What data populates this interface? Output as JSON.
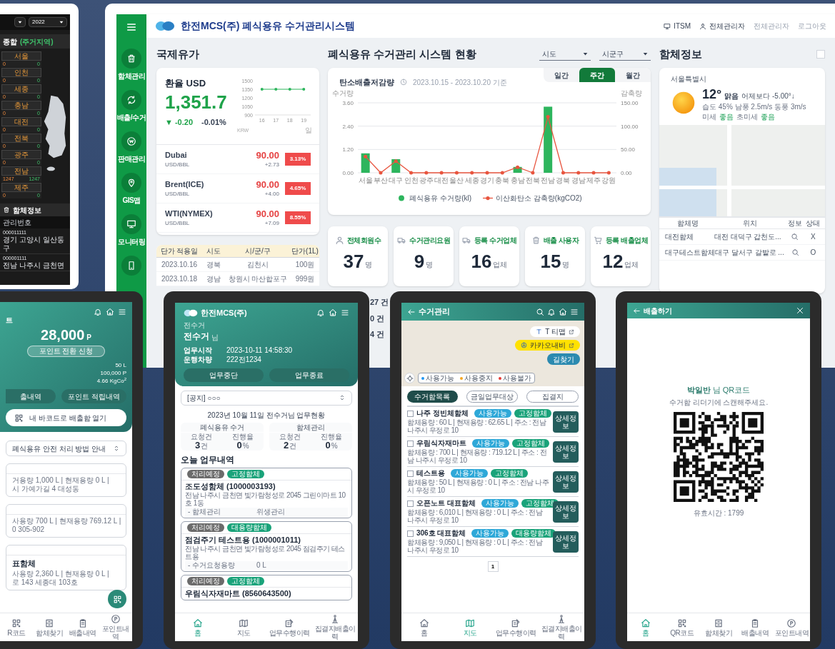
{
  "side_screen": {
    "year": "2022",
    "title": "종합",
    "subtitle": "(주거지역)",
    "regions": [
      {
        "name": "서울",
        "value_1": "0",
        "value_2": "0"
      },
      {
        "name": "인천",
        "value_1": "0",
        "value_2": "0"
      },
      {
        "name": "세종",
        "value_1": "0",
        "value_2": "0"
      },
      {
        "name": "충남",
        "value_1": "0",
        "value_2": "0"
      },
      {
        "name": "대전",
        "value_1": "0",
        "value_2": "0"
      },
      {
        "name": "전북",
        "value_1": "0",
        "value_2": "0"
      },
      {
        "name": "광주",
        "value_1": "0",
        "value_2": "0"
      },
      {
        "name": "전남",
        "value_1": "1247",
        "value_2": "1247"
      },
      {
        "name": "제주",
        "value_1": "0",
        "value_2": "0"
      }
    ],
    "section_title": "함체정보",
    "table_column": "관리번호",
    "rows": [
      {
        "id": "000011111",
        "address": "경기 고양시 일산동구"
      },
      {
        "id": "000001111",
        "address": "전남 나주시 금천면"
      }
    ]
  },
  "dashboard": {
    "logo": "한전MCS(주) 폐식용유 수거관리시스템",
    "header_links": [
      {
        "kind": "monitor",
        "label": "ITSM"
      },
      {
        "kind": "user",
        "label": "전체관리자"
      },
      {
        "kind": "text",
        "label": "전체관리자"
      },
      {
        "kind": "text",
        "label": "로그아웃"
      }
    ],
    "sidebar": [
      {
        "kind": "box",
        "label": "함체관리"
      },
      {
        "kind": "recycle",
        "label": "배출/수거"
      },
      {
        "kind": "won",
        "label": "판매관리"
      },
      {
        "kind": "pin",
        "label": "GIS맵"
      },
      {
        "kind": "monitor",
        "label": "모니터링"
      },
      {
        "kind": "phone"
      }
    ],
    "oil": {
      "title": "국제유가",
      "exchange": {
        "label": "환율 USD",
        "value": "1,351.7",
        "change": "▼ -0.20",
        "percent": "-0.01%",
        "chart_data": {
          "type": "line",
          "xlabel": "일",
          "ylabel": "KRW",
          "categories": [
            "16",
            "17",
            "18",
            "19"
          ],
          "series": [
            {
              "color": "#2db55d",
              "values": [
                1350,
                1350,
                1350,
                1350
              ]
            }
          ],
          "ylim": [
            900,
            1500
          ],
          "yticks": [
            900,
            1050,
            1200,
            1350,
            1500
          ]
        }
      },
      "prices": [
        {
          "name": "Dubai",
          "unit": "USD/BBL",
          "price": "90.00",
          "change": "+2.73",
          "percent": "3.13%"
        },
        {
          "name": "Brent(ICE)",
          "unit": "USD/BBL",
          "price": "90.00",
          "change": "+4.00",
          "percent": "4.65%"
        },
        {
          "name": "WTI(NYMEX)",
          "unit": "USD/BBL",
          "price": "90.00",
          "change": "+7.09",
          "percent": "8.55%"
        }
      ]
    },
    "price_table": {
      "columns": [
        "단가 적용일",
        "시도",
        "시/군/구",
        "단가(1L)"
      ],
      "rows": [
        [
          "2023.10.16",
          "경북",
          "김천시",
          "100원"
        ],
        [
          "2023.10.18",
          "경남",
          "창원시 마산합포구",
          "999원"
        ]
      ]
    },
    "status": {
      "title": "폐식용유 수거관리 시스템 현황",
      "filters": [
        {
          "label": "시도"
        },
        {
          "label": "시군구"
        }
      ],
      "chart": {
        "title": "탄소배출저감량",
        "period": "2023.10.15 - 2023.10.20 기준",
        "tabs": [
          {
            "label": "일간",
            "selected": false
          },
          {
            "label": "주간",
            "selected": true
          },
          {
            "label": "월간",
            "selected": false
          }
        ],
        "chart_data": {
          "type": "bar",
          "ylabel": "수거량",
          "y2label": "감축량",
          "categories": [
            "서울",
            "부산",
            "대구",
            "인천",
            "광주",
            "대전",
            "울산",
            "세종",
            "경기",
            "충북",
            "충남",
            "전북",
            "전남",
            "경북",
            "경남",
            "제주",
            "강원"
          ],
          "series": [
            {
              "name": "폐식용유 수거량(kl)",
              "color": "#2db55d",
              "values": [
                1.0,
                0,
                0.7,
                0,
                0,
                0,
                0,
                0,
                0,
                0,
                0.3,
                0,
                3.4,
                0,
                0,
                0,
                0
              ]
            },
            {
              "name": "이산화탄소 감축량(kgCO2)",
              "color": "#e8553f",
              "type": "line",
              "axis": "y2",
              "values": [
                35,
                0,
                25,
                0,
                0,
                0,
                0,
                0,
                0,
                0,
                12,
                0,
                120,
                0,
                0,
                0,
                0
              ]
            }
          ],
          "ylim": [
            0,
            3.6
          ],
          "yticks": [
            {
              "value": 0,
              "label": "0.00"
            },
            {
              "value": 1.2,
              "label": "1.20"
            },
            {
              "value": 2.4,
              "label": "2.40"
            },
            {
              "value": 3.6,
              "label": "3.60"
            }
          ],
          "y2lim": [
            0,
            150
          ],
          "y2ticks": [
            {
              "value": 0,
              "label": "0.00"
            },
            {
              "value": 50,
              "label": "50.00"
            },
            {
              "value": 100,
              "label": "100.00"
            },
            {
              "value": 150,
              "label": "150.00"
            }
          ]
        }
      },
      "stats": [
        {
          "kind": "user",
          "label": "전체회원수",
          "value": "37",
          "unit": "명"
        },
        {
          "kind": "truck",
          "label": "수거관리요원",
          "value": "9",
          "unit": "명"
        },
        {
          "kind": "truck",
          "label": "등록 수거업체",
          "value": "16",
          "unit": "업체"
        },
        {
          "kind": "box",
          "label": "배출 사용자",
          "value": "15",
          "unit": "명"
        },
        {
          "kind": "cart",
          "label": "등록 배출업체",
          "value": "12",
          "unit": "업체"
        }
      ],
      "counts": [
        "27 건",
        "0 건",
        "4 건"
      ]
    },
    "bin_info": {
      "title": "함체정보",
      "location": "서울특별시",
      "temperature": "12°",
      "condition": "맑음",
      "compare": "어제보다 -5.00°↓",
      "details": "습도 45% 남풍 2.5m/s 동풍 3m/s",
      "dust": [
        {
          "label": "미세",
          "grade": "좋음"
        },
        {
          "label": "초미세",
          "grade": "좋음"
        }
      ],
      "table": {
        "columns": [
          "함체명",
          "위치",
          "정보",
          "상태"
        ],
        "rows": [
          {
            "name": "대전함체",
            "location": "대전 대덕구 갑천도...",
            "status": "X"
          },
          {
            "name": "대구테스트함체",
            "location": "대구 달서구 갈밭로 ...",
            "status": "O"
          }
        ]
      }
    }
  },
  "point_app": {
    "title": "트",
    "points": "28,000",
    "points_unit": "P",
    "convert_button": "포인트 전환 신청",
    "stats": [
      "50 L",
      "100,000 P",
      "4.66 KgCo$^{2}$"
    ],
    "buttons": [
      "출내역",
      "포인트 적립내역"
    ],
    "barcode_button": "내 바코드로 배출함 열기",
    "notice": "폐식용유 안전 처리 방법 안내",
    "cards": [
      {
        "lines": [
          "거용량 1,000 L | 현재용량 0 L |",
          "시 가예가길 4 대성동"
        ]
      },
      {
        "lines": [
          "사용량 700 L | 현재용량 769.12 L |",
          "0 305-902"
        ]
      },
      {
        "title": "표함체",
        "lines": [
          "사용량 2,360 L | 현재용량 0 L |",
          "로 143 세종대 103호"
        ]
      }
    ],
    "nav": [
      {
        "kind": "qr",
        "label": "R코드",
        "selected": false
      },
      {
        "kind": "locker",
        "label": "함체찾기",
        "selected": false
      },
      {
        "kind": "clipboard",
        "label": "배출내역",
        "selected": false
      },
      {
        "kind": "point",
        "label": "포인트내역",
        "selected": false
      }
    ]
  },
  "worker_app": {
    "brand": "한전MCS(주)",
    "role": "전수거",
    "user": "전수거",
    "honorific": "님",
    "info": [
      {
        "label": "업무시작",
        "value": "2023-10-11 14:58:30"
      },
      {
        "label": "운행차량",
        "value": "222전1234"
      }
    ],
    "buttons": [
      "업무중단",
      "업무종료"
    ],
    "notice": "[공지] ○○○",
    "summary_title": "2023년 10월 11일 전수거님 업무현황",
    "summary": [
      {
        "title": "폐식용유 수거",
        "items": [
          {
            "label": "요청건",
            "value": "3",
            "unit": "건"
          },
          {
            "label": "진행율",
            "value": "0",
            "unit": "%"
          }
        ]
      },
      {
        "title": "함체관리",
        "items": [
          {
            "label": "요청건",
            "value": "2",
            "unit": "건"
          },
          {
            "label": "진행율",
            "value": "0",
            "unit": "%"
          }
        ]
      }
    ],
    "today_title": "오늘 업무내역",
    "tasks": [
      {
        "tags": [
          {
            "label": "처리예정",
            "color": "#6b6b6b"
          },
          {
            "label": "고정함체",
            "color": "#1aa37a"
          }
        ],
        "title": "조도성함체 (1000003193)",
        "address": "전남 나주시 금천면 빛가람청성로 2045 그린이마트 10호 1동",
        "detail_label": "- 함체관리",
        "detail_value": "위생관리"
      },
      {
        "tags": [
          {
            "label": "처리예정",
            "color": "#6b6b6b"
          },
          {
            "label": "대용량함체",
            "color": "#1aa37a"
          }
        ],
        "title": "점검주기 테스트용 (1000001011)",
        "address": "전남 나주시 금천면 빛가람청성로 2045 점검주기 테스트용",
        "detail_label": "- 수거요청용량",
        "detail_value": "0 L"
      },
      {
        "tags": [
          {
            "label": "처리예정",
            "color": "#6b6b6b"
          },
          {
            "label": "고정함체",
            "color": "#1aa37a"
          }
        ],
        "title": "우림식자재마트 (8560643500)"
      }
    ],
    "nav": [
      {
        "kind": "home",
        "label": "홈",
        "selected": true
      },
      {
        "kind": "map",
        "label": "지도",
        "selected": false
      },
      {
        "kind": "task",
        "label": "업무수행이력",
        "selected": false
      },
      {
        "kind": "cone",
        "label": "집결지배출이력",
        "selected": false
      }
    ]
  },
  "collection_app": {
    "title": "수거관리",
    "map_buttons": [
      {
        "kind": "tmap",
        "label": "T 티맵"
      },
      {
        "kind": "kakao",
        "label": "카카오내비"
      }
    ],
    "route_button": "길찾기",
    "legend": [
      {
        "label": "사용가능",
        "color": "#2196f3"
      },
      {
        "label": "사용중지",
        "color": "#f5a623"
      },
      {
        "label": "사용불가",
        "color": "#e53935"
      }
    ],
    "tabs": [
      {
        "label": "수거함목록",
        "selected": true
      },
      {
        "label": "금일업무대상",
        "selected": false
      },
      {
        "label": "집결지",
        "selected": false
      }
    ],
    "bins": [
      {
        "name": "나주 정빈체함체",
        "checked": false,
        "tags": [
          {
            "label": "사용가능",
            "color": "#2ea8d8"
          },
          {
            "label": "고정함체",
            "color": "#1aa37a"
          }
        ],
        "info": "함체용량 : 60 L | 현재용량 : 62.65 L | 주소 : 전남 나주시 우정로 10",
        "button": "상세정보"
      },
      {
        "name": "우림식자재마트",
        "checked": false,
        "tags": [
          {
            "label": "사용가능",
            "color": "#2ea8d8"
          },
          {
            "label": "고정함체",
            "color": "#1aa37a"
          }
        ],
        "info": "함체용량 : 700 L | 현재용량 : 719.12 L | 주소 : 전남 나주시 우정로 10",
        "button": "상세정보"
      },
      {
        "name": "테스트용",
        "checked": false,
        "tags": [
          {
            "label": "사용가능",
            "color": "#2ea8d8"
          },
          {
            "label": "고정함체",
            "color": "#1aa37a"
          }
        ],
        "info": "함체용량 : 50 L | 현재용량 : 0 L | 주소 : 전남 나주시 우정로 10",
        "button": "상세정보"
      },
      {
        "name": "오픈노트 대표함체",
        "checked": false,
        "tags": [
          {
            "label": "사용가능",
            "color": "#2ea8d8"
          },
          {
            "label": "고정함체",
            "color": "#1aa37a"
          }
        ],
        "info": "함체용량 : 6,010 L | 현재용량 : 0 L | 주소 : 전남 나주시 우정로 10",
        "button": "상세정보"
      },
      {
        "name": "306호 대표함체",
        "checked": false,
        "tags": [
          {
            "label": "사용가능",
            "color": "#2ea8d8"
          },
          {
            "label": "대용량함체",
            "color": "#1aa37a"
          }
        ],
        "info": "함체용량 : 9,050 L | 현재용량 : 0 L | 주소 : 전남 나주시 우정로 10",
        "button": "상세정보"
      }
    ],
    "pages": [
      {
        "label": "1",
        "selected": true
      }
    ],
    "nav": [
      {
        "kind": "home",
        "label": "홈",
        "selected": false
      },
      {
        "kind": "map",
        "label": "지도",
        "selected": true
      },
      {
        "kind": "task",
        "label": "업무수행이력",
        "selected": false
      },
      {
        "kind": "cone",
        "label": "집결지배출이력",
        "selected": false
      }
    ]
  },
  "qr_app": {
    "title": "배출하기",
    "heading": "**박일반** 님 QR코드",
    "instruction": "수거함 리더기에 스캔해주세요.",
    "validity": "유효시간 : 1799",
    "nav": [
      {
        "kind": "home",
        "label": "홈",
        "selected": true
      },
      {
        "kind": "qr",
        "label": "QR코드",
        "selected": false
      },
      {
        "kind": "locker",
        "label": "함체찾기",
        "selected": false
      },
      {
        "kind": "clipboard",
        "label": "배출내역",
        "selected": false
      },
      {
        "kind": "point",
        "label": "포인트내역",
        "selected": false
      }
    ]
  }
}
